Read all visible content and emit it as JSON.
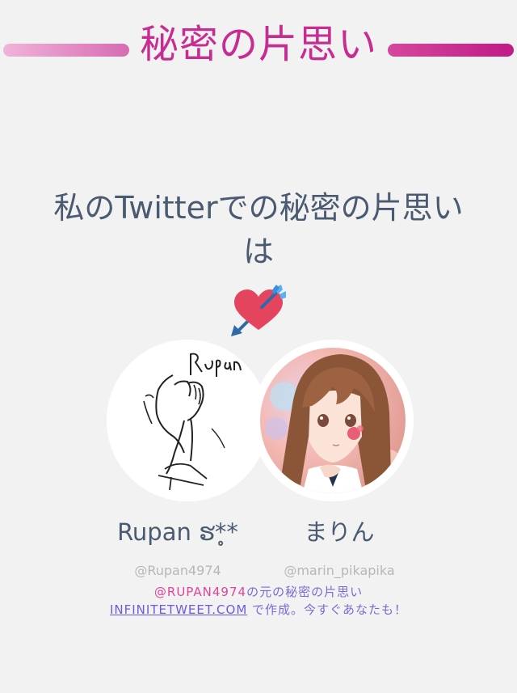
{
  "header": {
    "title": "秘密の片思い"
  },
  "main": {
    "headline": "私のTwitterでの秘密の片思いは"
  },
  "profiles": [
    {
      "name": "Rupan ຮ*̥*",
      "handle": "@Rupan4974"
    },
    {
      "name": "まりん",
      "handle": "@marin_pikapika"
    }
  ],
  "footer": {
    "mention": "@RUPAN4974",
    "line1_rest": "の元の秘密の片思い",
    "link": "INFINITETWEET.COM",
    "line2_rest": " で作成。今すぐあなたも！"
  },
  "colors": {
    "title": "#c72c93",
    "text": "#4a5a70",
    "handle": "#b7b7b7",
    "mention": "#e0449a",
    "link": "#6b5be0"
  },
  "icons": {
    "emoji": "heart-with-arrow-icon"
  }
}
